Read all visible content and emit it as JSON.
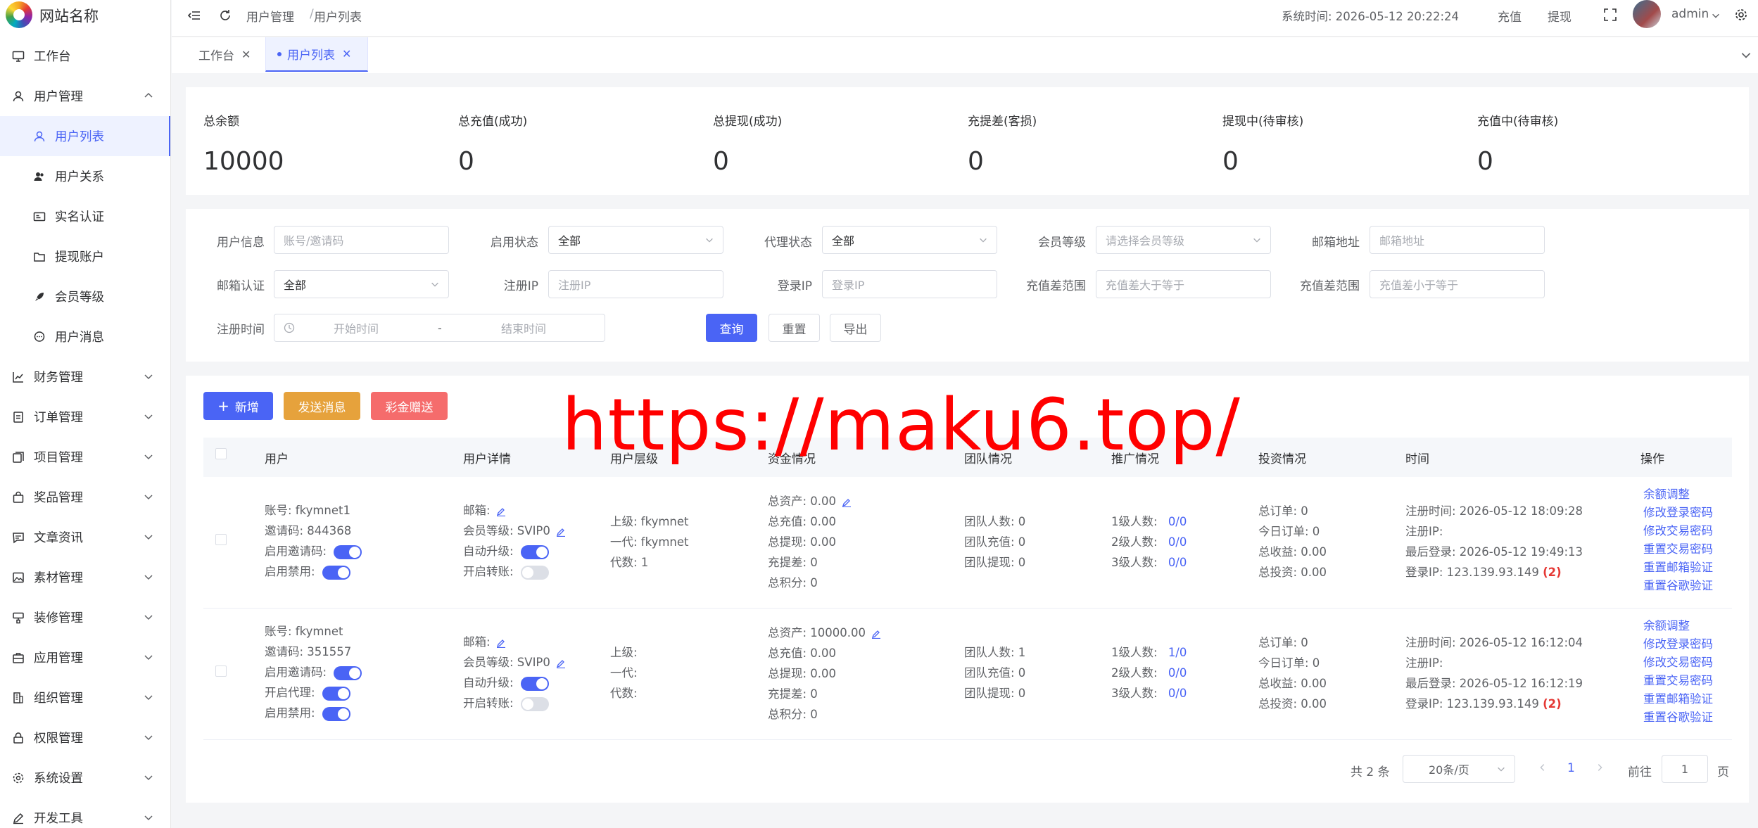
{
  "site": {
    "name": "网站名称"
  },
  "sidebar": {
    "items": [
      {
        "label": "工作台"
      },
      {
        "label": "用户管理"
      },
      {
        "label": "用户列表"
      },
      {
        "label": "用户关系"
      },
      {
        "label": "实名认证"
      },
      {
        "label": "提现账户"
      },
      {
        "label": "会员等级"
      },
      {
        "label": "用户消息"
      },
      {
        "label": "财务管理"
      },
      {
        "label": "订单管理"
      },
      {
        "label": "项目管理"
      },
      {
        "label": "奖品管理"
      },
      {
        "label": "文章资讯"
      },
      {
        "label": "素材管理"
      },
      {
        "label": "装修管理"
      },
      {
        "label": "应用管理"
      },
      {
        "label": "组织管理"
      },
      {
        "label": "权限管理"
      },
      {
        "label": "系统设置"
      },
      {
        "label": "开发工具"
      }
    ]
  },
  "header": {
    "breadcrumb": [
      "用户管理",
      "用户列表"
    ],
    "breadcrumb_sep": "/",
    "system_time": "系统时间: 2026-05-12 20:22:24",
    "recharge": "充值",
    "withdraw": "提现",
    "username": "admin"
  },
  "tabs": [
    {
      "label": "工作台"
    },
    {
      "label": "用户列表"
    }
  ],
  "stats": [
    {
      "label": "总余额",
      "value": "10000"
    },
    {
      "label": "总充值(成功)",
      "value": "0"
    },
    {
      "label": "总提现(成功)",
      "value": "0"
    },
    {
      "label": "充提差(客损)",
      "value": "0"
    },
    {
      "label": "提现中(待审核)",
      "value": "0"
    },
    {
      "label": "充值中(待审核)",
      "value": "0"
    }
  ],
  "filters": {
    "user_info": {
      "label": "用户信息",
      "placeholder": "账号/邀请码"
    },
    "enable_status": {
      "label": "启用状态",
      "value": "全部"
    },
    "agent_status": {
      "label": "代理状态",
      "value": "全部"
    },
    "member_level": {
      "label": "会员等级",
      "placeholder": "请选择会员等级"
    },
    "email": {
      "label": "邮箱地址",
      "placeholder": "邮箱地址"
    },
    "email_verify": {
      "label": "邮箱认证",
      "value": "全部"
    },
    "reg_ip": {
      "label": "注册IP",
      "placeholder": "注册IP"
    },
    "login_ip": {
      "label": "登录IP",
      "placeholder": "登录IP"
    },
    "diff_min": {
      "label": "充值差范围",
      "placeholder": "充值差大于等于"
    },
    "diff_max": {
      "label": "充值差范围",
      "placeholder": "充值差小于等于"
    },
    "reg_time": {
      "label": "注册时间",
      "start": "开始时间",
      "sep": "-",
      "end": "结束时间"
    },
    "query": "查询",
    "reset": "重置",
    "export": "导出"
  },
  "actions": {
    "add": "新增",
    "send_msg": "发送消息",
    "bonus": "彩金赠送"
  },
  "watermark": "https://maku6.top/",
  "table": {
    "columns": [
      "用户",
      "用户详情",
      "用户层级",
      "资金情况",
      "团队情况",
      "推广情况",
      "投资情况",
      "时间",
      "操作"
    ],
    "rows": [
      {
        "user": [
          "账号: fkymnet1",
          "邀请码: 844368",
          "启用邀请码:",
          "启用禁用:"
        ],
        "detail": [
          "邮箱:",
          "会员等级: SVIP0",
          "自动升级:",
          "开启转账:"
        ],
        "level": [
          "上级: fkymnet",
          "一代: fkymnet",
          "代数: 1"
        ],
        "funds": [
          "总资产: 0.00",
          "总充值: 0.00",
          "总提现: 0.00",
          "充提差:  0",
          "总积分: 0"
        ],
        "team": [
          "团队人数: 0",
          "团队充值: 0",
          "团队提现: 0"
        ],
        "promo": [
          {
            "label": "1级人数:",
            "value": "0/0"
          },
          {
            "label": "2级人数:",
            "value": "0/0"
          },
          {
            "label": "3级人数:",
            "value": "0/0"
          }
        ],
        "invest": [
          "总订单: 0",
          "今日订单: 0",
          "总收益: 0.00",
          "总投资: 0.00"
        ],
        "time": [
          "注册时间: 2026-05-12 18:09:28",
          "注册IP:",
          "最后登录: 2026-05-12 19:49:13",
          "登录IP: 123.139.93.149",
          "(2)"
        ]
      },
      {
        "user": [
          "账号: fkymnet",
          "邀请码: 351557",
          "启用邀请码:",
          "开启代理:",
          "启用禁用:"
        ],
        "detail": [
          "邮箱:",
          "会员等级: SVIP0",
          "自动升级:",
          "开启转账:"
        ],
        "level": [
          "上级:",
          "一代:",
          "代数:"
        ],
        "funds": [
          "总资产: 10000.00",
          "总充值: 0.00",
          "总提现: 0.00",
          "充提差:  0",
          "总积分: 0"
        ],
        "team": [
          "团队人数: 1",
          "团队充值: 0",
          "团队提现: 0"
        ],
        "promo": [
          {
            "label": "1级人数:",
            "value": "1/0"
          },
          {
            "label": "2级人数:",
            "value": "0/0"
          },
          {
            "label": "3级人数:",
            "value": "0/0"
          }
        ],
        "invest": [
          "总订单: 0",
          "今日订单: 0",
          "总收益: 0.00",
          "总投资: 0.00"
        ],
        "time": [
          "注册时间: 2026-05-12 16:12:04",
          "注册IP:",
          "最后登录: 2026-05-12 16:12:19",
          "登录IP: 123.139.93.149",
          "(2)"
        ]
      }
    ],
    "ops": [
      "余额调整",
      "修改登录密码",
      "修改交易密码",
      "重置交易密码",
      "重置邮箱验证",
      "重置谷歌验证"
    ]
  },
  "pagination": {
    "total": "共 2 条",
    "page_size": "20条/页",
    "current": "1",
    "goto": "前往",
    "goto_value": "1",
    "page_unit": "页"
  },
  "colors": {
    "primary": "#4a64f5",
    "warning": "#e6a23c",
    "danger": "#f56c6c",
    "watermark": "#ff0000"
  }
}
